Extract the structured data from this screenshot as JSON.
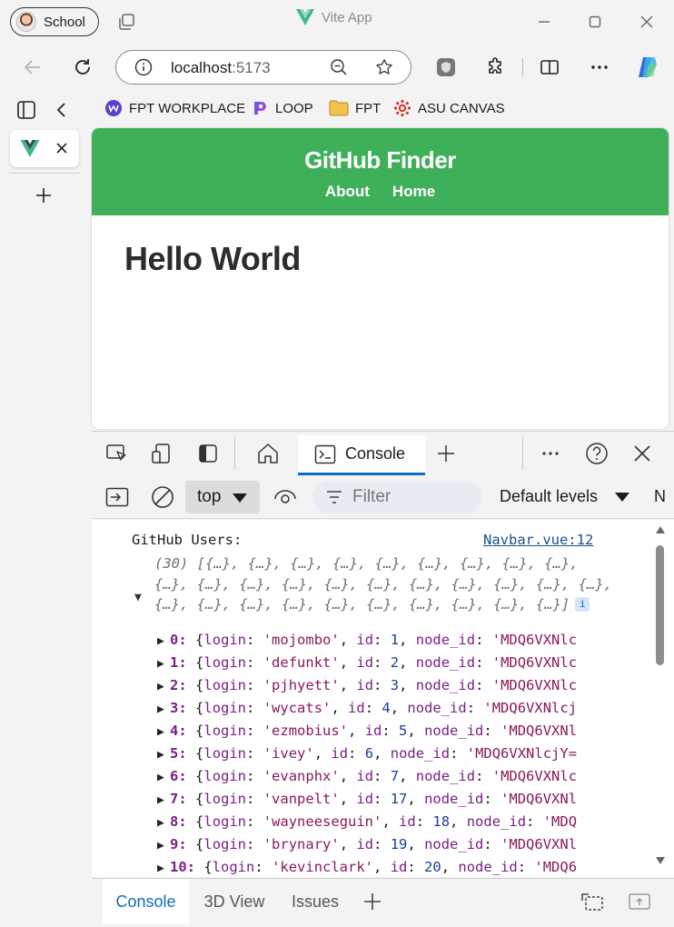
{
  "browser": {
    "profile_label": "School",
    "window_title": "Vite App",
    "url_host": "localhost",
    "url_port": ":5173",
    "favorites": [
      {
        "label": "FPT WORKPLACE",
        "icon": "workplace-icon",
        "color": "#5b3fd1"
      },
      {
        "label": "LOOP",
        "icon": "loop-icon",
        "color": "#8a35e0"
      },
      {
        "label": "FPT",
        "icon": "folder-icon",
        "color": "#e8b22c"
      },
      {
        "label": "ASU CANVAS",
        "icon": "canvas-icon",
        "color": "#d33a2c"
      }
    ]
  },
  "page": {
    "brand": "GitHub Finder",
    "nav": [
      "About",
      "Home"
    ],
    "heading": "Hello World",
    "header_color": "#3fb05a"
  },
  "devtools": {
    "console_tab": "Console",
    "context": "top",
    "filter_placeholder": "Filter",
    "levels": "Default levels",
    "cut_label": "N",
    "log_label": "GitHub Users:",
    "log_source": "Navbar.vue:12",
    "array_summary": "(30) [{…}, {…}, {…}, {…}, {…}, {…}, {…}, {…}, {…}, {…}, {…}, {…}, {…}, {…}, {…}, {…}, {…}, {…}, {…}, {…}, {…}, {…}, {…}, {…}, {…}, {…}, {…}, {…}, {…}, {…}]",
    "info_badge": "i",
    "entries": [
      {
        "idx": "0",
        "login": "'mojombo'",
        "id": "1",
        "node": "'MDQ6VXNlc"
      },
      {
        "idx": "1",
        "login": "'defunkt'",
        "id": "2",
        "node": "'MDQ6VXNlc"
      },
      {
        "idx": "2",
        "login": "'pjhyett'",
        "id": "3",
        "node": "'MDQ6VXNlc"
      },
      {
        "idx": "3",
        "login": "'wycats'",
        "id": "4",
        "node": "'MDQ6VXNlcj"
      },
      {
        "idx": "4",
        "login": "'ezmobius'",
        "id": "5",
        "node": "'MDQ6VXNl"
      },
      {
        "idx": "5",
        "login": "'ivey'",
        "id": "6",
        "node": "'MDQ6VXNlcjY="
      },
      {
        "idx": "6",
        "login": "'evanphx'",
        "id": "7",
        "node": "'MDQ6VXNlc"
      },
      {
        "idx": "7",
        "login": "'vanpelt'",
        "id": "17",
        "node": "'MDQ6VXNl"
      },
      {
        "idx": "8",
        "login": "'wayneeseguin'",
        "id": "18",
        "node": "'MDQ"
      },
      {
        "idx": "9",
        "login": "'brynary'",
        "id": "19",
        "node": "'MDQ6VXNl"
      },
      {
        "idx": "10",
        "login": "'kevinclark'",
        "id": "20",
        "node": "'MDQ6"
      }
    ],
    "drawer_tabs": [
      "Console",
      "3D View",
      "Issues"
    ]
  }
}
